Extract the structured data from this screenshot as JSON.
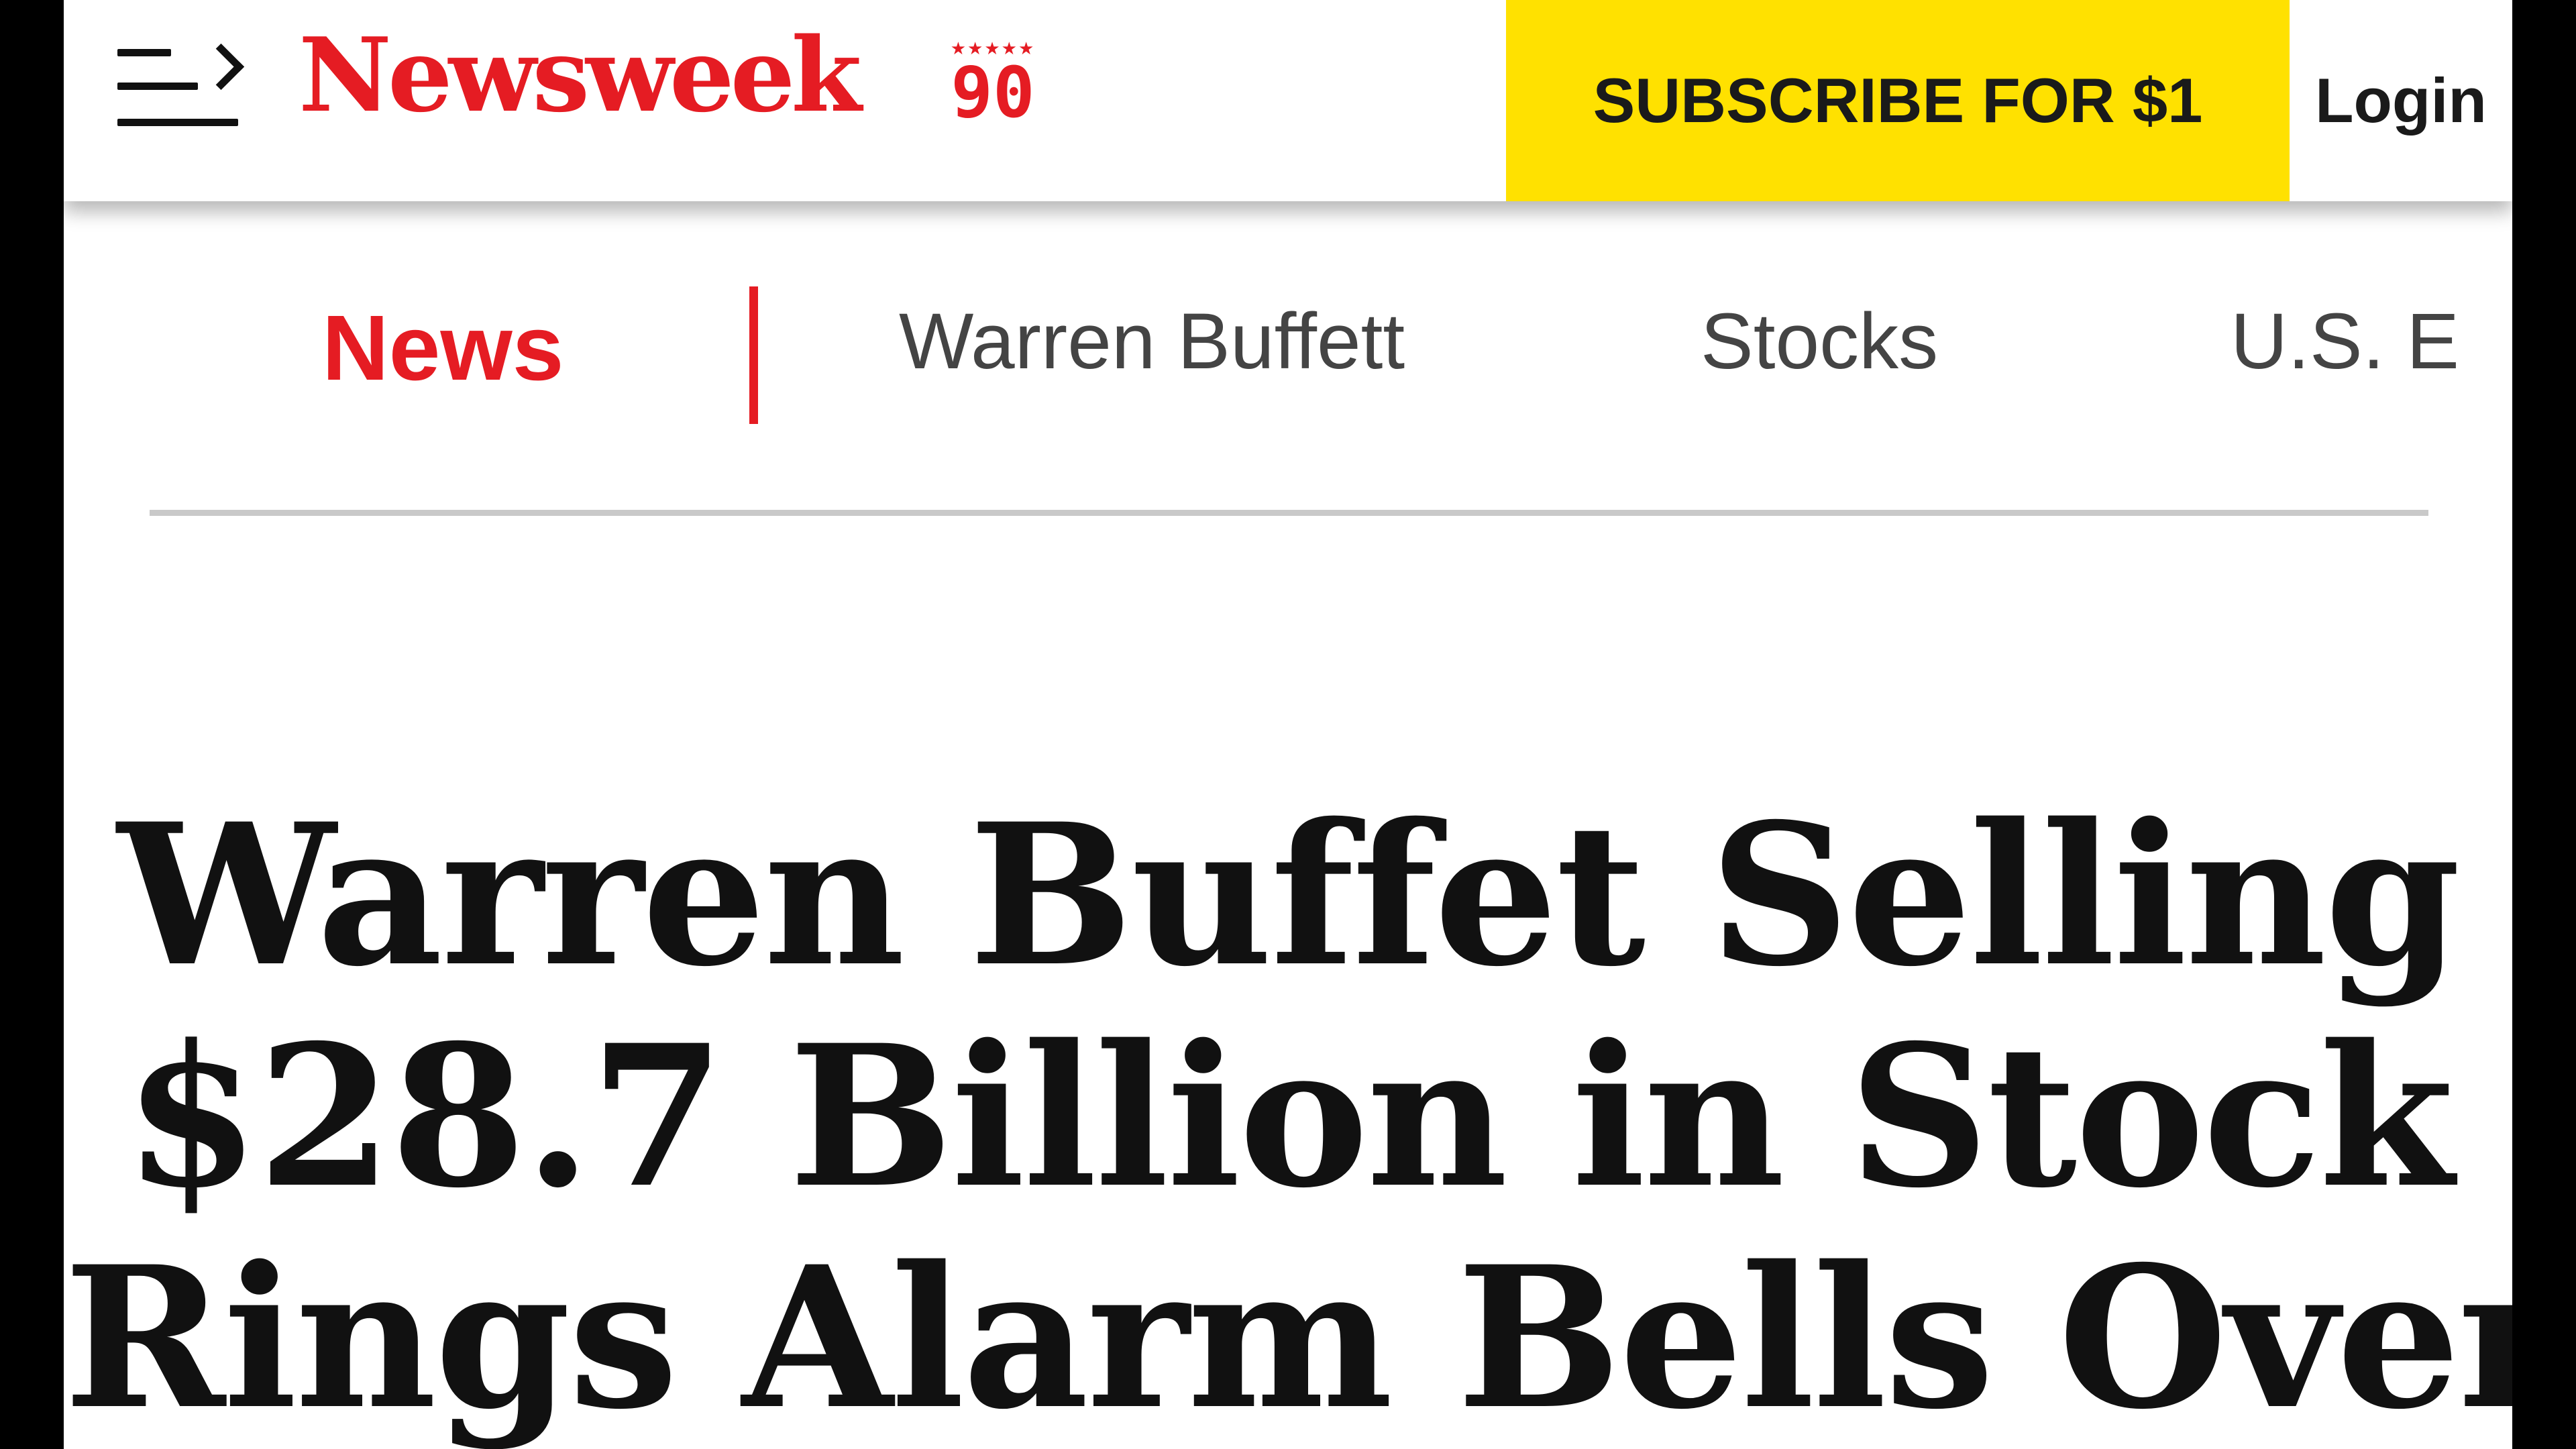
{
  "header": {
    "menu_icon": "menu-arrow-icon",
    "logo_text": "Newsweek",
    "anniversary": {
      "stars": "★★★★★",
      "number": "90"
    },
    "subscribe_label": "SUBSCRIBE FOR $1",
    "login_label": "Login",
    "colors": {
      "brand": "#e51c23",
      "subscribe_bg": "#ffe100"
    }
  },
  "nav": {
    "items": [
      {
        "label": "News",
        "active": true
      },
      {
        "label": "Warren Buffett",
        "active": false
      },
      {
        "label": "Stocks",
        "active": false
      },
      {
        "label": "U.S. E",
        "active": false
      }
    ]
  },
  "article": {
    "headline_lines": [
      "Warren Buffet Selling",
      "$28.7 Billion in Stock",
      "Rings Alarm Bells Over"
    ]
  }
}
